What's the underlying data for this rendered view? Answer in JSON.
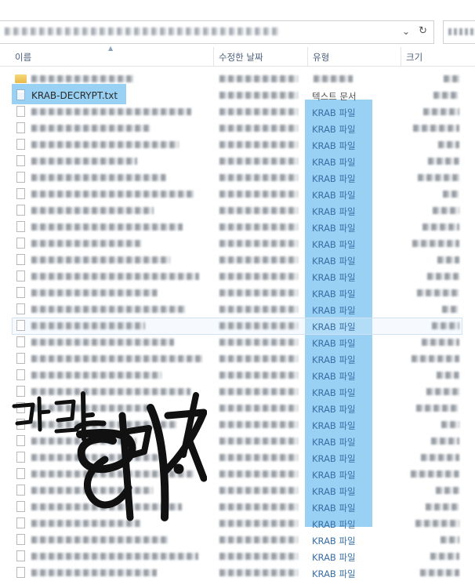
{
  "header": {
    "col_name": "이름",
    "col_modified": "수정한 날짜",
    "col_type": "유형",
    "col_size": "크기"
  },
  "address_bar": {
    "chevron": "⌄",
    "refresh": "↻"
  },
  "files": [
    {
      "name": "",
      "type": "",
      "icon": "folder-icon"
    },
    {
      "name": "KRAB-DECRYPT.txt",
      "type": "텍스트 문서",
      "icon": "text-file-icon",
      "selected": true
    },
    {
      "name": "",
      "type": "KRAB 파일",
      "icon": "file-icon"
    },
    {
      "name": "",
      "type": "KRAB 파일",
      "icon": "file-icon"
    },
    {
      "name": "",
      "type": "KRAB 파일",
      "icon": "file-icon"
    },
    {
      "name": "",
      "type": "KRAB 파일",
      "icon": "file-icon"
    },
    {
      "name": "",
      "type": "KRAB 파일",
      "icon": "file-icon"
    },
    {
      "name": "",
      "type": "KRAB 파일",
      "icon": "file-icon"
    },
    {
      "name": "",
      "type": "KRAB 파일",
      "icon": "file-icon"
    },
    {
      "name": "",
      "type": "KRAB 파일",
      "icon": "file-icon"
    },
    {
      "name": "",
      "type": "KRAB 파일",
      "icon": "file-icon"
    },
    {
      "name": "",
      "type": "KRAB 파일",
      "icon": "file-icon"
    },
    {
      "name": "",
      "type": "KRAB 파일",
      "icon": "file-icon"
    },
    {
      "name": "",
      "type": "KRAB 파일",
      "icon": "file-icon"
    },
    {
      "name": "",
      "type": "KRAB 파일",
      "icon": "file-icon"
    },
    {
      "name": "",
      "type": "KRAB 파일",
      "icon": "file-icon"
    },
    {
      "name": "",
      "type": "KRAB 파일",
      "icon": "file-icon"
    },
    {
      "name": "",
      "type": "KRAB 파일",
      "icon": "file-icon"
    },
    {
      "name": "",
      "type": "KRAB 파일",
      "icon": "file-icon"
    },
    {
      "name": "",
      "type": "KRAB 파일",
      "icon": "file-icon"
    },
    {
      "name": "",
      "type": "KRAB 파일",
      "icon": "file-icon"
    },
    {
      "name": "",
      "type": "KRAB 파일",
      "icon": "file-icon"
    },
    {
      "name": "",
      "type": "KRAB 파일",
      "icon": "file-icon"
    },
    {
      "name": "",
      "type": "KRAB 파일",
      "icon": "file-icon"
    },
    {
      "name": "",
      "type": "KRAB 파일",
      "icon": "file-icon"
    },
    {
      "name": "",
      "type": "KRAB 파일",
      "icon": "file-icon"
    },
    {
      "name": "",
      "type": "KRAB 파일",
      "icon": "file-icon"
    },
    {
      "name": "",
      "type": "KRAB 파일",
      "icon": "file-icon"
    },
    {
      "name": "",
      "type": "KRAB 파일",
      "icon": "file-icon"
    },
    {
      "name": "",
      "type": "KRAB 파일",
      "icon": "file-icon"
    },
    {
      "name": "",
      "type": "KRAB 파일",
      "icon": "file-icon"
    }
  ],
  "watermark": {
    "text": "닥터 해킹",
    "style": "brush-calligraphy"
  },
  "colors": {
    "selection": "#99d1f5",
    "header_text": "#4c607a",
    "type_text": "#3a6fa5"
  }
}
